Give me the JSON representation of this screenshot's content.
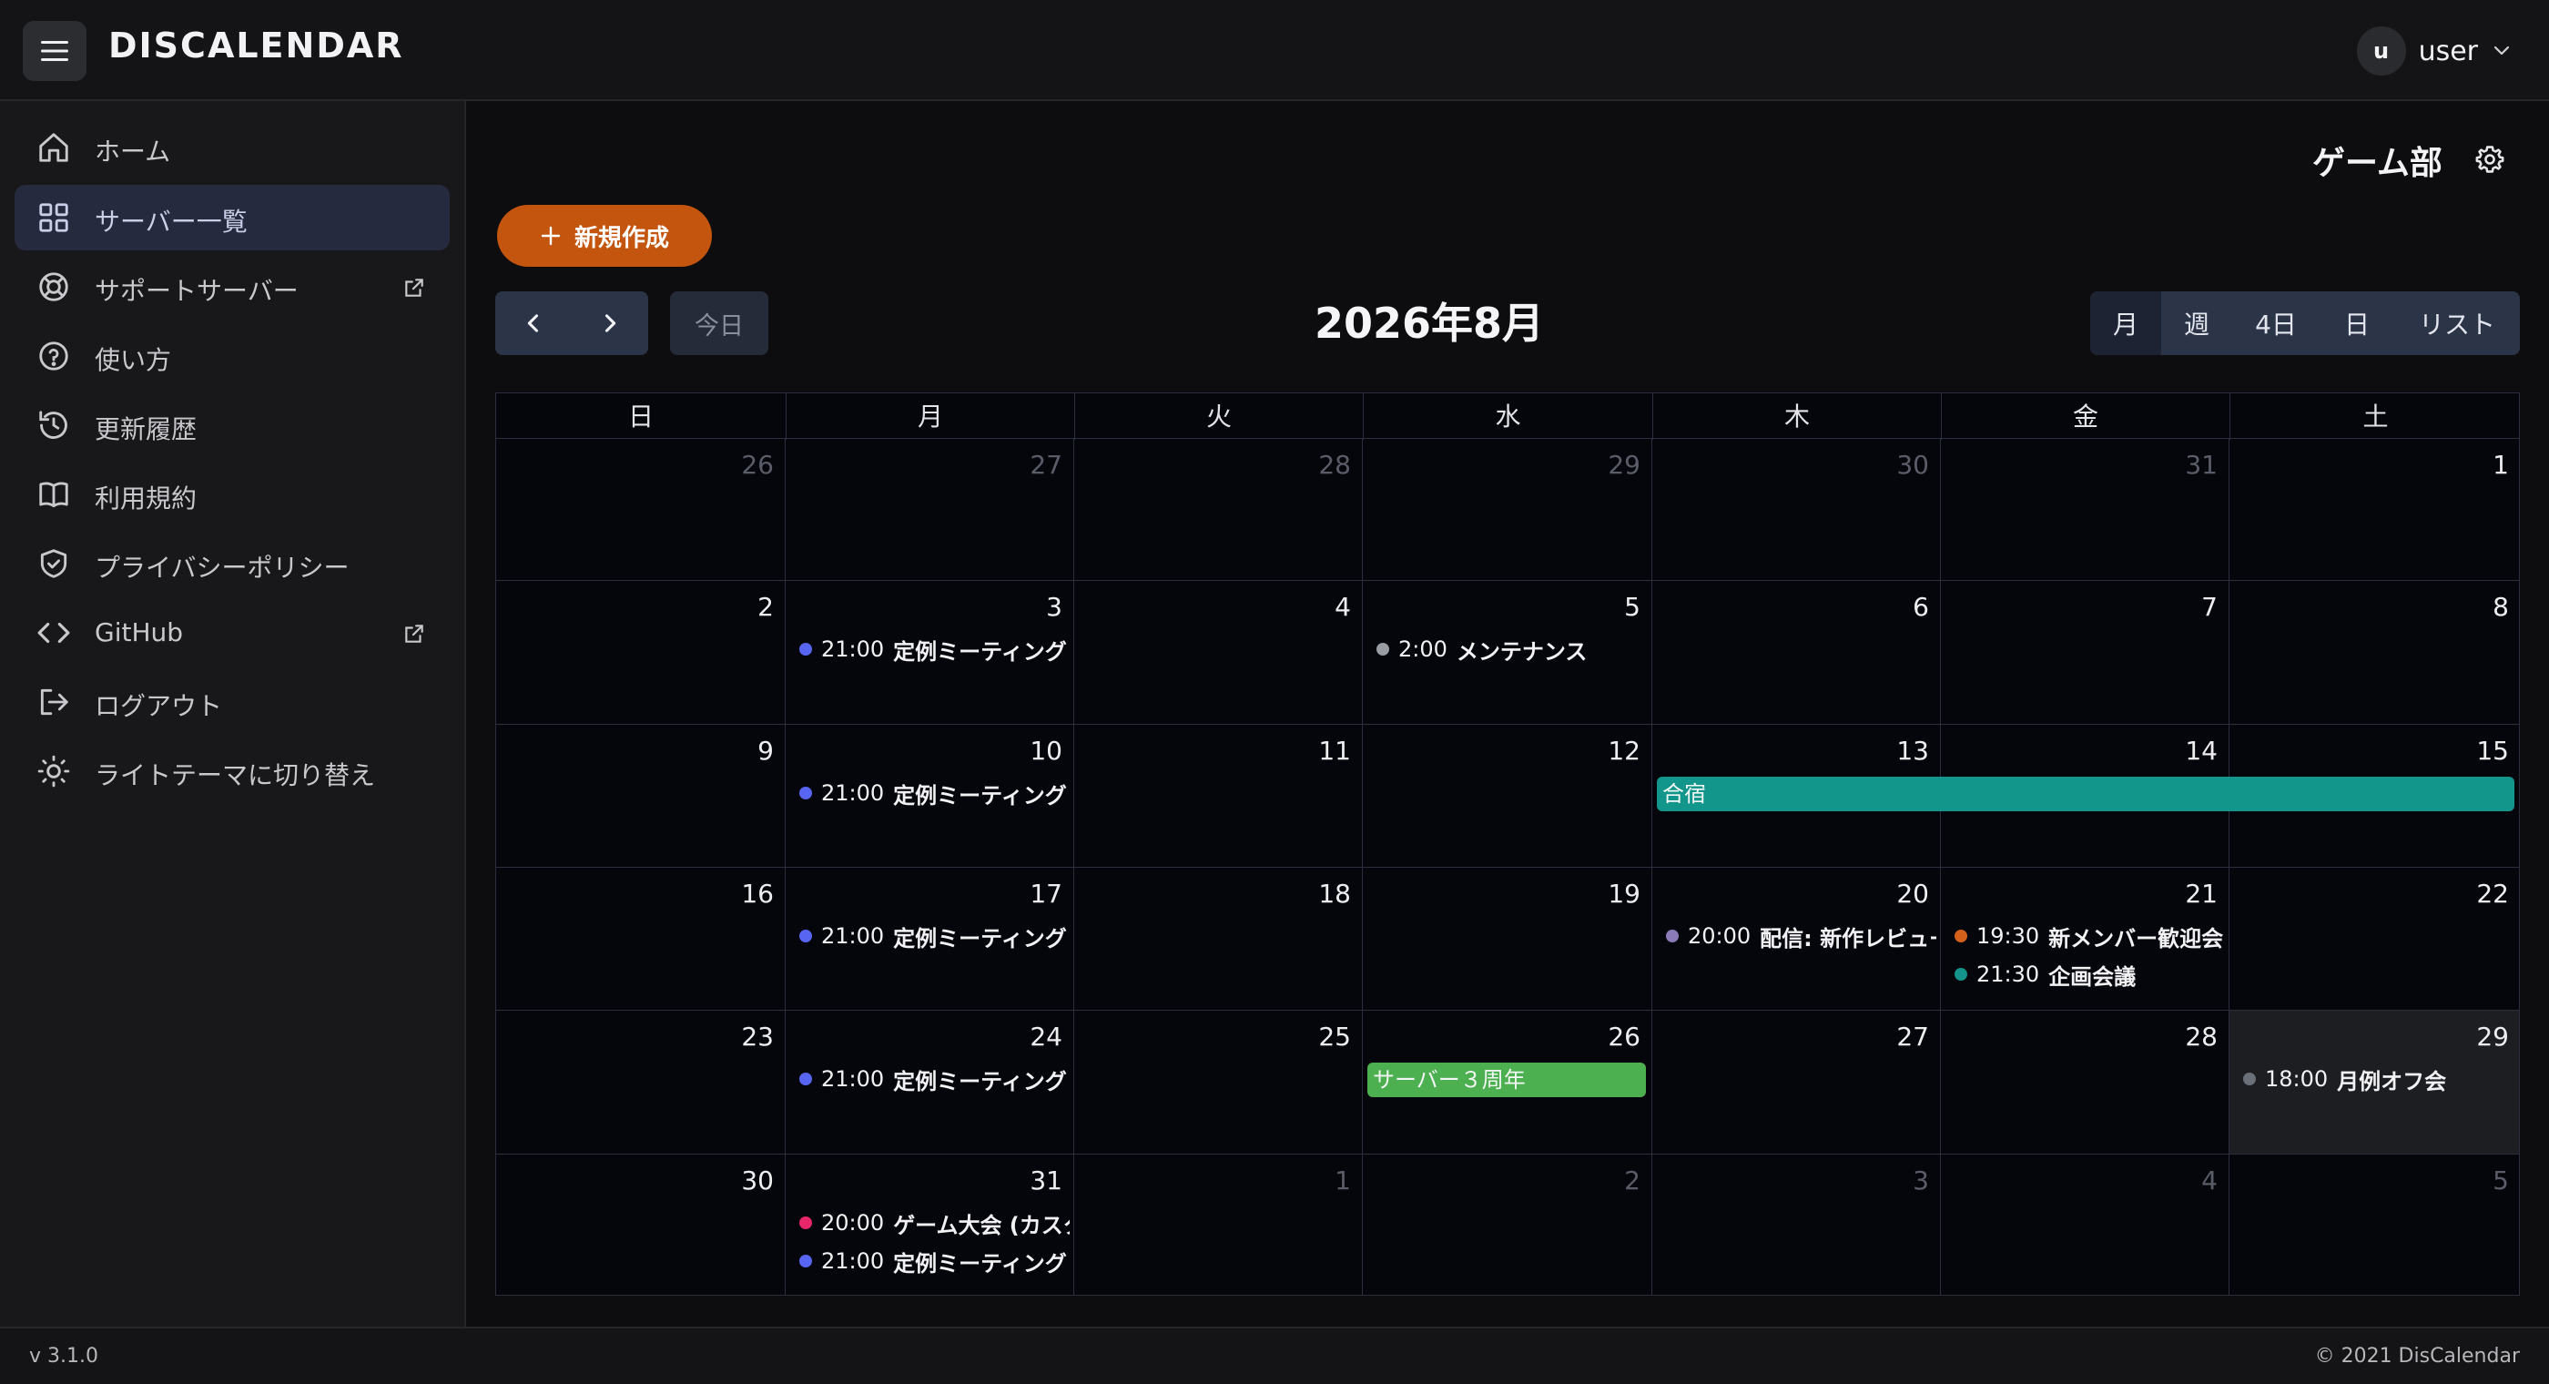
{
  "app": {
    "brand": "DISCALENDAR"
  },
  "user": {
    "initial": "u",
    "name": "user"
  },
  "sidebar": {
    "items": [
      {
        "label": "ホーム",
        "icon": "home-icon"
      },
      {
        "label": "サーバー一覧",
        "icon": "grid-icon",
        "active": true
      },
      {
        "label": "サポートサーバー",
        "icon": "lifebuoy-icon",
        "external": true
      },
      {
        "label": "使い方",
        "icon": "help-icon"
      },
      {
        "label": "更新履歴",
        "icon": "history-icon"
      },
      {
        "label": "利用規約",
        "icon": "book-icon"
      },
      {
        "label": "プライバシーポリシー",
        "icon": "shield-icon"
      },
      {
        "label": "GitHub",
        "icon": "code-icon",
        "external": true
      },
      {
        "label": "ログアウト",
        "icon": "logout-icon"
      },
      {
        "label": "ライトテーマに切り替え",
        "icon": "sun-icon"
      }
    ]
  },
  "main": {
    "server_name": "ゲーム部",
    "new_button": "新規作成",
    "today_button": "今日",
    "month_title": "2026年8月",
    "views": [
      "月",
      "週",
      "4日",
      "日",
      "リスト"
    ],
    "active_view": "月"
  },
  "calendar": {
    "weekdays": [
      "日",
      "月",
      "火",
      "水",
      "木",
      "金",
      "土"
    ],
    "weeks": [
      [
        {
          "d": "26",
          "o": true
        },
        {
          "d": "27",
          "o": true
        },
        {
          "d": "28",
          "o": true
        },
        {
          "d": "29",
          "o": true
        },
        {
          "d": "30",
          "o": true
        },
        {
          "d": "31",
          "o": true
        },
        {
          "d": "1"
        }
      ],
      [
        {
          "d": "2"
        },
        {
          "d": "3"
        },
        {
          "d": "4"
        },
        {
          "d": "5"
        },
        {
          "d": "6"
        },
        {
          "d": "7"
        },
        {
          "d": "8"
        }
      ],
      [
        {
          "d": "9"
        },
        {
          "d": "10"
        },
        {
          "d": "11"
        },
        {
          "d": "12"
        },
        {
          "d": "13"
        },
        {
          "d": "14"
        },
        {
          "d": "15"
        }
      ],
      [
        {
          "d": "16"
        },
        {
          "d": "17"
        },
        {
          "d": "18"
        },
        {
          "d": "19"
        },
        {
          "d": "20"
        },
        {
          "d": "21"
        },
        {
          "d": "22"
        }
      ],
      [
        {
          "d": "23"
        },
        {
          "d": "24"
        },
        {
          "d": "25"
        },
        {
          "d": "26"
        },
        {
          "d": "27"
        },
        {
          "d": "28"
        },
        {
          "d": "29",
          "today": true
        }
      ],
      [
        {
          "d": "30"
        },
        {
          "d": "31"
        },
        {
          "d": "1",
          "o": true
        },
        {
          "d": "2",
          "o": true
        },
        {
          "d": "3",
          "o": true
        },
        {
          "d": "4",
          "o": true
        },
        {
          "d": "5",
          "o": true
        }
      ]
    ],
    "events": [
      {
        "week": 1,
        "day": 1,
        "slot": 0,
        "time": "21:00",
        "title": "定例ミーティング",
        "color": "#5865f2"
      },
      {
        "week": 1,
        "day": 3,
        "slot": 0,
        "time": "2:00",
        "title": "メンテナンス",
        "color": "#9a9ca3"
      },
      {
        "week": 2,
        "day": 1,
        "slot": 0,
        "time": "21:00",
        "title": "定例ミーティング",
        "color": "#5865f2"
      },
      {
        "week": 3,
        "day": 1,
        "slot": 0,
        "time": "21:00",
        "title": "定例ミーティング",
        "color": "#5865f2"
      },
      {
        "week": 3,
        "day": 4,
        "slot": 0,
        "time": "20:00",
        "title": "配信: 新作レビュー",
        "color": "#8b7bb8"
      },
      {
        "week": 3,
        "day": 5,
        "slot": 0,
        "time": "19:30",
        "title": "新メンバー歓迎会",
        "color": "#d4601c"
      },
      {
        "week": 3,
        "day": 5,
        "slot": 1,
        "time": "21:30",
        "title": "企画会議",
        "color": "#15948c"
      },
      {
        "week": 4,
        "day": 1,
        "slot": 0,
        "time": "21:00",
        "title": "定例ミーティング",
        "color": "#5865f2"
      },
      {
        "week": 4,
        "day": 6,
        "slot": 0,
        "time": "18:00",
        "title": "月例オフ会",
        "color": "#6b7078"
      },
      {
        "week": 5,
        "day": 1,
        "slot": 0,
        "time": "20:00",
        "title": "ゲーム大会 (カスタム",
        "color": "#e8266a"
      },
      {
        "week": 5,
        "day": 1,
        "slot": 1,
        "time": "21:00",
        "title": "定例ミーティング",
        "color": "#5865f2"
      }
    ],
    "all_day": [
      {
        "week": 2,
        "start": 4,
        "end": 6,
        "title": "合宿",
        "color": "#12968c"
      },
      {
        "week": 4,
        "start": 3,
        "end": 3,
        "title": "サーバー３周年",
        "color": "#4caf50"
      }
    ]
  },
  "footer": {
    "version": "v 3.1.0",
    "copyright": "© 2021 DisCalendar"
  }
}
